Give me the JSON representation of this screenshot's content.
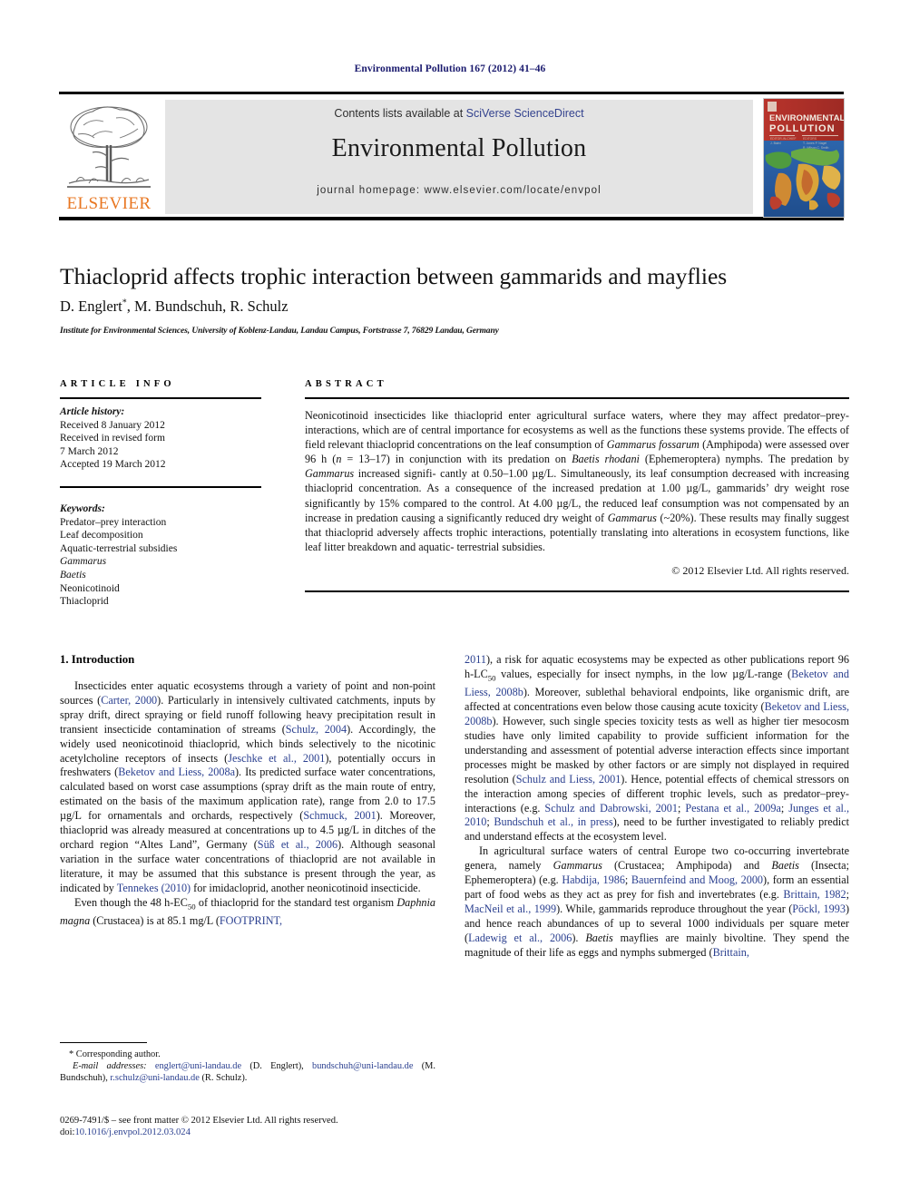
{
  "running_head": "Environmental Pollution 167 (2012) 41–46",
  "masthead": {
    "contents_prefix": "Contents lists available at ",
    "contents_link": "SciVerse ScienceDirect",
    "journal_title": "Environmental Pollution",
    "homepage": "journal homepage: www.elsevier.com/locate/envpol",
    "publisher_wordmark": "ELSEVIER",
    "cover_title_line1": "ENVIRONMENTAL",
    "cover_title_line2": "POLLUTION",
    "band_color": "#e4e4e4",
    "link_color": "#33428e",
    "elsevier_orange": "#e87722"
  },
  "article": {
    "title": "Thiacloprid affects trophic interaction between gammarids and mayflies",
    "authors": "D. Englert, M. Bundschuh, R. Schulz",
    "corresponding_marker": "*",
    "affiliation": "Institute for Environmental Sciences, University of Koblenz-Landau, Landau Campus, Fortstrasse 7, 76829 Landau, Germany"
  },
  "article_info": {
    "heading": "ARTICLE INFO",
    "history_label": "Article history:",
    "history": [
      "Received 8 January 2012",
      "Received in revised form",
      "7 March 2012",
      "Accepted 19 March 2012"
    ],
    "keywords_label": "Keywords:",
    "keywords": [
      "Predator–prey interaction",
      "Leaf decomposition",
      "Aquatic-terrestrial subsidies",
      "Gammarus",
      "Baetis",
      "Neonicotinoid",
      "Thiacloprid"
    ],
    "keywords_italic": [
      "Gammarus",
      "Baetis"
    ]
  },
  "abstract": {
    "heading": "ABSTRACT",
    "text": "Neonicotinoid insecticides like thiacloprid enter agricultural surface waters, where they may affect predator–prey-interactions, which are of central importance for ecosystems as well as the functions these systems provide. The effects of field relevant thiacloprid concentrations on the leaf consumption of Gammarus fossarum (Amphipoda) were assessed over 96 h (n = 13–17) in conjunction with its predation on Baetis rhodani (Ephemeroptera) nymphs. The predation by Gammarus increased significantly at 0.50–1.00 µg/L. Simultaneously, its leaf consumption decreased with increasing thiacloprid concentration. As a consequence of the increased predation at 1.00 µg/L, gammarids' dry weight rose significantly by 15% compared to the control. At 4.00 µg/L, the reduced leaf consumption was not compensated by an increase in predation causing a significantly reduced dry weight of Gammarus (~20%). These results may finally suggest that thiacloprid adversely affects trophic interactions, potentially translating into alterations in ecosystem functions, like leaf litter breakdown and aquatic-terrestrial subsidies.",
    "copyright": "© 2012 Elsevier Ltd. All rights reserved."
  },
  "introduction": {
    "heading": "1. Introduction",
    "left_paragraph_1": "Insecticides enter aquatic ecosystems through a variety of point and non-point sources (Carter, 2000). Particularly in intensively cultivated catchments, inputs by spray drift, direct spraying or field runoff following heavy precipitation result in transient insecticide contamination of streams (Schulz, 2004). Accordingly, the widely used neonicotinoid thiacloprid, which binds selectively to the nicotinic acetylcholine receptors of insects (Jeschke et al., 2001), potentially occurs in freshwaters (Beketov and Liess, 2008a). Its predicted surface water concentrations, calculated based on worst case assumptions (spray drift as the main route of entry, estimated on the basis of the maximum application rate), range from 2.0 to 17.5 µg/L for ornamentals and orchards, respectively (Schmuck, 2001). Moreover, thiacloprid was already measured at concentrations up to 4.5 µg/L in ditches of the orchard region \"Altes Land\", Germany (Süß et al., 2006). Although seasonal variation in the surface water concentrations of thiacloprid are not available in literature, it may be assumed that this substance is present through the year, as indicated by Tennekes (2010) for imidacloprid, another neonicotinoid insecticide.",
    "left_paragraph_2": "Even though the 48 h-EC50 of thiacloprid for the standard test organism Daphnia magna (Crustacea) is at 85.1 mg/L (FOOTPRINT,",
    "right_paragraph_1": "2011), a risk for aquatic ecosystems may be expected as other publications report 96 h-LC50 values, especially for insect nymphs, in the low µg/L-range (Beketov and Liess, 2008b). Moreover, sublethal behavioral endpoints, like organismic drift, are affected at concentrations even below those causing acute toxicity (Beketov and Liess, 2008b). However, such single species toxicity tests as well as higher tier mesocosm studies have only limited capability to provide sufficient information for the understanding and assessment of potential adverse interaction effects since important processes might be masked by other factors or are simply not displayed in required resolution (Schulz and Liess, 2001). Hence, potential effects of chemical stressors on the interaction among species of different trophic levels, such as predator–prey-interactions (e.g. Schulz and Dabrowski, 2001; Pestana et al., 2009a; Junges et al., 2010; Bundschuh et al., in press), need to be further investigated to reliably predict and understand effects at the ecosystem level.",
    "right_paragraph_2": "In agricultural surface waters of central Europe two co-occurring invertebrate genera, namely Gammarus (Crustacea; Amphipoda) and Baetis (Insecta; Ephemeroptera) (e.g. Habdija, 1986; Bauernfeind and Moog, 2000), form an essential part of food webs as they act as prey for fish and invertebrates (e.g. Brittain, 1982; MacNeil et al., 1999). While, gammarids reproduce throughout the year (Pöckl, 1993) and hence reach abundances of up to several 1000 individuals per square meter (Ladewig et al., 2006). Baetis mayflies are mainly bivoltine. They spend the magnitude of their life as eggs and nymphs submerged (Brittain,"
  },
  "footnotes": {
    "corresponding_author": "* Corresponding author.",
    "email_label": "E-mail addresses:",
    "emails": "englert@uni-landau.de (D. Englert), bundschuh@uni-landau.de (M. Bundschuh), r.schulz@uni-landau.de (R. Schulz).",
    "imprint_line1": "0269-7491/$ – see front matter © 2012 Elsevier Ltd. All rights reserved.",
    "imprint_doi_label": "doi:",
    "imprint_doi": "10.1016/j.envpol.2012.03.024"
  }
}
